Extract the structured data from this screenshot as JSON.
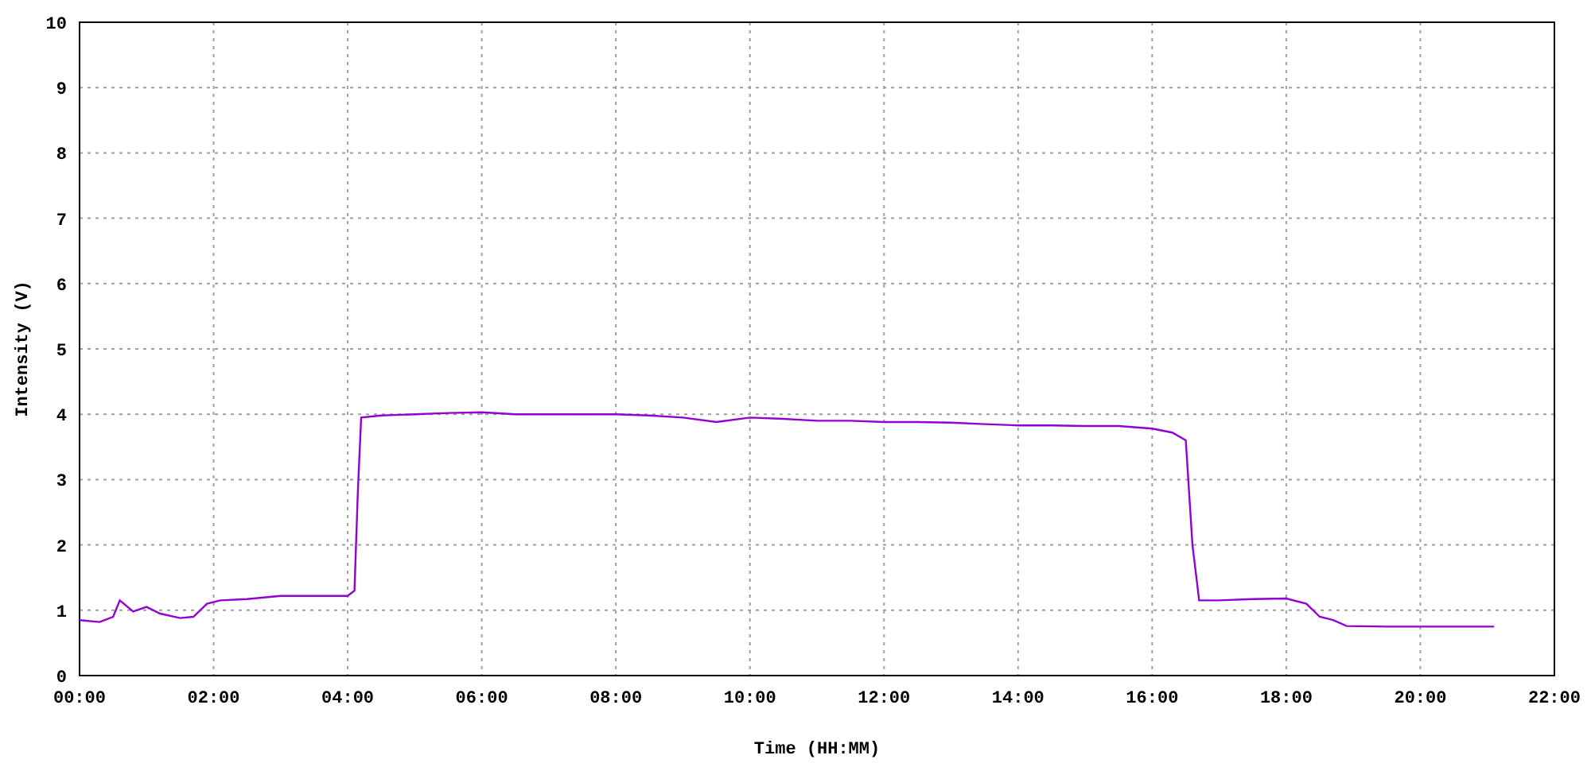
{
  "chart_data": {
    "type": "line",
    "grid": true,
    "xlabel": "Time (HH:MM)",
    "ylabel": "Intensity (V)",
    "xlim": [
      0,
      22
    ],
    "ylim": [
      0,
      10
    ],
    "x": [
      0,
      0.3,
      0.5,
      0.6,
      0.8,
      1,
      1.2,
      1.5,
      1.7,
      1.9,
      2.1,
      2.5,
      3,
      3.5,
      4,
      4.1,
      4.15,
      4.2,
      4.5,
      5,
      5.5,
      6,
      6.5,
      7,
      7.5,
      8,
      8.5,
      9,
      9.5,
      10,
      10.5,
      11,
      11.5,
      12,
      12.5,
      13,
      13.5,
      14,
      14.5,
      15,
      15.5,
      16,
      16.3,
      16.5,
      16.6,
      16.7,
      17,
      17.5,
      18,
      18.3,
      18.5,
      18.7,
      18.9,
      19.5,
      20,
      20.5,
      21,
      21.1
    ],
    "series": [
      {
        "color": "#9400d3",
        "values": [
          0.85,
          0.82,
          0.9,
          1.15,
          0.98,
          1.05,
          0.95,
          0.88,
          0.9,
          1.1,
          1.15,
          1.17,
          1.22,
          1.22,
          1.22,
          1.3,
          2.8,
          3.95,
          3.98,
          4.0,
          4.02,
          4.03,
          4.0,
          4.0,
          4.0,
          4.0,
          3.98,
          3.95,
          3.88,
          3.95,
          3.93,
          3.9,
          3.9,
          3.88,
          3.88,
          3.87,
          3.85,
          3.83,
          3.83,
          3.82,
          3.82,
          3.78,
          3.72,
          3.6,
          2.0,
          1.15,
          1.15,
          1.17,
          1.18,
          1.1,
          0.9,
          0.85,
          0.76,
          0.75,
          0.75,
          0.75,
          0.75,
          0.75
        ]
      }
    ],
    "xticks": [
      {
        "value": 0,
        "label": "00:00"
      },
      {
        "value": 2,
        "label": "02:00"
      },
      {
        "value": 4,
        "label": "04:00"
      },
      {
        "value": 6,
        "label": "06:00"
      },
      {
        "value": 8,
        "label": "08:00"
      },
      {
        "value": 10,
        "label": "10:00"
      },
      {
        "value": 12,
        "label": "12:00"
      },
      {
        "value": 14,
        "label": "14:00"
      },
      {
        "value": 16,
        "label": "16:00"
      },
      {
        "value": 18,
        "label": "18:00"
      },
      {
        "value": 20,
        "label": "20:00"
      },
      {
        "value": 22,
        "label": "22:00"
      }
    ],
    "yticks": [
      0,
      1,
      2,
      3,
      4,
      5,
      6,
      7,
      8,
      9,
      10
    ]
  }
}
